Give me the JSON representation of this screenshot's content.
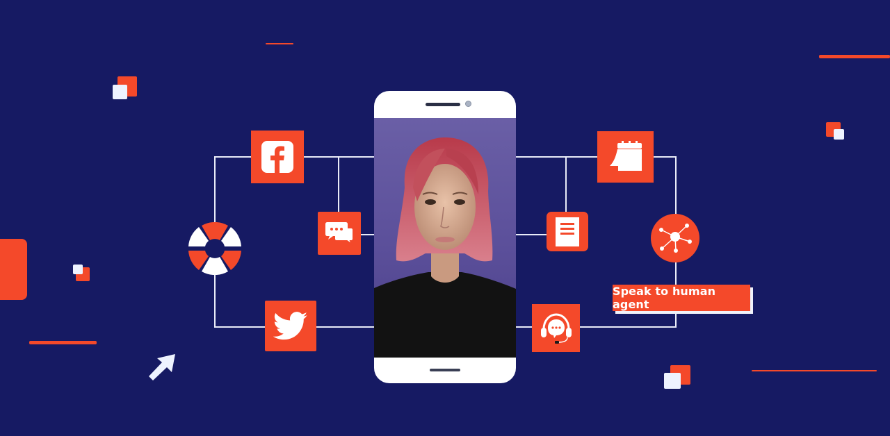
{
  "theme": {
    "background": "#161a63",
    "accent": "#f4492a",
    "line": "#e9ecf8",
    "light": "#eef3ff"
  },
  "diagram": {
    "left_channels": [
      {
        "name": "Facebook",
        "icon": "facebook-icon"
      },
      {
        "name": "Live chat",
        "icon": "chat-bubbles-icon"
      },
      {
        "name": "Twitter",
        "icon": "twitter-icon"
      },
      {
        "name": "Support",
        "icon": "lifebuoy-icon"
      }
    ],
    "right_channels": [
      {
        "name": "Calendar",
        "icon": "calendar-icon"
      },
      {
        "name": "Document",
        "icon": "document-icon"
      },
      {
        "name": "Network",
        "icon": "network-hub-icon"
      },
      {
        "name": "Headset support",
        "icon": "headset-icon"
      }
    ],
    "center": {
      "name": "Virtual assistant avatar on phone",
      "icon": "phone-avatar"
    }
  },
  "cta": {
    "label": "Speak to human agent"
  },
  "decor": {
    "cursor": "cursor-arrow-icon"
  }
}
